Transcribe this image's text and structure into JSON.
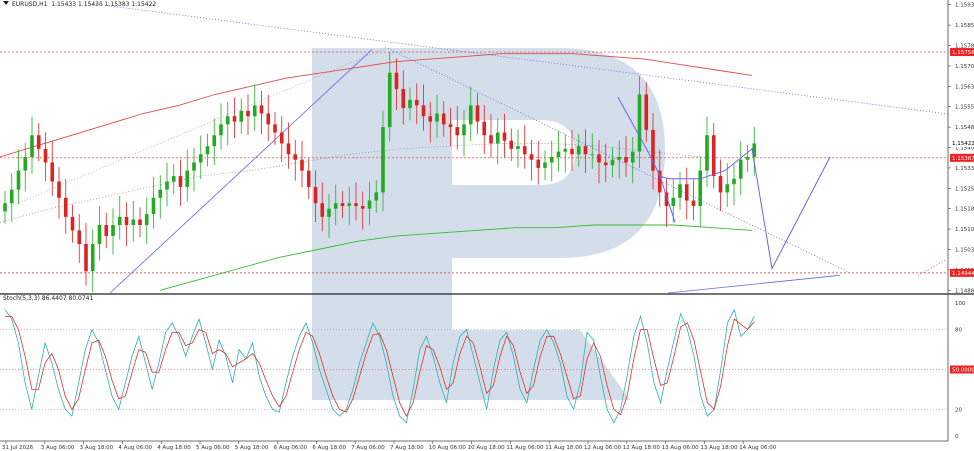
{
  "header": {
    "symbol": "EURUSD,H1",
    "ohlc": "1.15433 1.15435 1.15383 1.15422"
  },
  "stoch_header": {
    "label": "Stoch(5,3,3) 86.4407 80.0741"
  },
  "colors": {
    "bull": "#22aa22",
    "bear": "#dd2222",
    "level_line": "#dd3333",
    "price_tag_bg": "#ee2222",
    "forecast": "#6666ee",
    "ma_slow_red": "#e04a4a",
    "ma_slow_green": "#33bb33",
    "stoch_main": "#2ab0b0",
    "stoch_signal": "#e03030",
    "watermark": "#b8c8dc"
  },
  "chart_data": [
    {
      "type": "candlestick",
      "y_ticks": [
        "1.15930",
        "1.15855",
        "1.15780",
        "1.15705",
        "1.15630",
        "1.15555",
        "1.15480",
        "1.15405",
        "1.15330",
        "1.15255",
        "1.15180",
        "1.15105",
        "1.15030",
        "1.14955",
        "1.14880"
      ],
      "ylim": [
        1.1487,
        1.1594
      ],
      "price_tags": [
        {
          "value": 1.15756,
          "label": "1.15756"
        },
        {
          "value": 1.15422,
          "label": "1.15422"
        },
        {
          "value": 1.15367,
          "label": "1.15367"
        },
        {
          "value": 1.14944,
          "label": "1.14944"
        }
      ],
      "horizontal_levels": [
        1.15756,
        1.15367,
        1.14944
      ],
      "x_ticks": [
        "31 Jul 2026",
        "3 Aug 06:00",
        "3 Aug 18:00",
        "4 Aug 06:00",
        "4 Aug 18:00",
        "5 Aug 06:00",
        "5 Aug 18:00",
        "6 Aug 06:00",
        "6 Aug 18:00",
        "7 Aug 06:00",
        "7 Aug 18:00",
        "10 Aug 06:00",
        "10 Aug 18:00",
        "11 Aug 06:00",
        "11 Aug 18:00",
        "12 Aug 06:00",
        "12 Aug 18:00",
        "13 Aug 06:00",
        "13 Aug 18:00",
        "14 Aug 06:00"
      ],
      "closes": [
        1.152,
        1.1525,
        1.1532,
        1.1537,
        1.1545,
        1.154,
        1.1535,
        1.1528,
        1.1522,
        1.1515,
        1.151,
        1.1505,
        1.1495,
        1.1505,
        1.1512,
        1.1508,
        1.1512,
        1.1515,
        1.1512,
        1.1514,
        1.1512,
        1.1516,
        1.1522,
        1.1525,
        1.1528,
        1.153,
        1.1526,
        1.1532,
        1.1535,
        1.1538,
        1.1541,
        1.1545,
        1.1549,
        1.1552,
        1.155,
        1.1554,
        1.1552,
        1.1556,
        1.1553,
        1.1549,
        1.1546,
        1.1542,
        1.1538,
        1.1536,
        1.1532,
        1.1526,
        1.152,
        1.1515,
        1.1518,
        1.152,
        1.1519,
        1.152,
        1.1519,
        1.1518,
        1.1521,
        1.1524,
        1.1548,
        1.1568,
        1.1562,
        1.1555,
        1.1558,
        1.1556,
        1.1552,
        1.155,
        1.1553,
        1.1549,
        1.1548,
        1.1545,
        1.1549,
        1.1556,
        1.155,
        1.1545,
        1.1542,
        1.1546,
        1.1543,
        1.154,
        1.1541,
        1.1538,
        1.1536,
        1.1533,
        1.1535,
        1.1537,
        1.1539,
        1.154,
        1.1538,
        1.1541,
        1.1538,
        1.1538,
        1.1535,
        1.1534,
        1.1536,
        1.1537,
        1.1535,
        1.1539,
        1.156,
        1.1547,
        1.1532,
        1.1524,
        1.1519,
        1.1522,
        1.1527,
        1.1521,
        1.1519,
        1.1532,
        1.1545,
        1.153,
        1.1524,
        1.1527,
        1.1529,
        1.1536,
        1.1537,
        1.1542
      ],
      "ma_slow_red": [
        1.1537,
        1.1541,
        1.1545,
        1.1549,
        1.1553,
        1.1556,
        1.156,
        1.1563,
        1.1566,
        1.1568,
        1.157,
        1.1572,
        1.1573,
        1.1574,
        1.1575,
        1.1575,
        1.1575,
        1.1574,
        1.1573,
        1.1571,
        1.1569,
        1.1567
      ],
      "ma_slow_green": [
        1.1488,
        1.1492,
        1.1496,
        1.15,
        1.1503,
        1.1506,
        1.1508,
        1.1509,
        1.151,
        1.1511,
        1.1511,
        1.1512,
        1.1512,
        1.1512,
        1.1511,
        1.151
      ],
      "ma_mid_dotted": [
        1.1513,
        1.1518,
        1.1522,
        1.1526,
        1.153,
        1.1532,
        1.1535,
        1.1538,
        1.154,
        1.1541,
        1.1542,
        1.1542,
        1.1541,
        1.1539,
        1.1537
      ],
      "forecast_path": [
        [
          1.1489
        ],
        [
          1.1576
        ],
        [
          1.1551
        ],
        [
          1.1532
        ],
        [
          1.1514
        ],
        [
          1.1561
        ],
        [
          1.1534
        ],
        [
          1.1519
        ],
        [
          1.1535
        ],
        [
          1.153
        ],
        [
          1.1496
        ],
        [
          1.1537
        ]
      ],
      "trend_lines": "dotted descending resistance and diagonal supports"
    },
    {
      "type": "line",
      "indicator": "stochastic",
      "y_ticks": [
        "100",
        "80",
        "50.0000",
        "20",
        "0"
      ],
      "ylim": [
        0,
        100
      ],
      "levels": [
        80,
        50,
        20
      ],
      "series": [
        {
          "name": "main",
          "values": [
            95,
            88,
            70,
            40,
            20,
            45,
            70,
            55,
            35,
            20,
            15,
            40,
            65,
            80,
            70,
            50,
            30,
            20,
            40,
            60,
            75,
            55,
            35,
            55,
            78,
            85,
            75,
            60,
            75,
            88,
            70,
            50,
            72,
            60,
            40,
            65,
            58,
            70,
            45,
            30,
            20,
            18,
            40,
            60,
            75,
            85,
            70,
            50,
            35,
            20,
            15,
            20,
            35,
            55,
            70,
            85,
            75,
            55,
            30,
            15,
            10,
            35,
            65,
            75,
            60,
            40,
            25,
            55,
            75,
            80,
            60,
            40,
            20,
            50,
            72,
            78,
            60,
            35,
            25,
            50,
            72,
            80,
            70,
            55,
            30,
            20,
            40,
            78,
            72,
            45,
            20,
            10,
            20,
            45,
            75,
            90,
            70,
            40,
            25,
            50,
            72,
            92,
            80,
            60,
            30,
            15,
            20,
            50,
            85,
            95,
            75,
            80,
            90
          ]
        },
        {
          "name": "signal",
          "values": [
            90,
            90,
            80,
            60,
            35,
            35,
            55,
            62,
            50,
            30,
            20,
            28,
            50,
            70,
            72,
            60,
            42,
            28,
            30,
            48,
            65,
            63,
            48,
            48,
            65,
            78,
            78,
            68,
            70,
            80,
            78,
            62,
            65,
            62,
            52,
            55,
            58,
            62,
            55,
            42,
            30,
            22,
            30,
            48,
            65,
            78,
            75,
            62,
            45,
            30,
            20,
            18,
            28,
            45,
            62,
            76,
            77,
            65,
            45,
            25,
            15,
            25,
            48,
            68,
            65,
            52,
            35,
            40,
            62,
            75,
            70,
            52,
            32,
            38,
            60,
            75,
            68,
            48,
            32,
            38,
            60,
            75,
            75,
            62,
            45,
            28,
            30,
            58,
            70,
            60,
            38,
            20,
            16,
            30,
            58,
            80,
            80,
            58,
            38,
            40,
            60,
            82,
            85,
            72,
            48,
            25,
            20,
            38,
            68,
            88,
            84,
            80,
            86
          ]
        }
      ]
    }
  ]
}
